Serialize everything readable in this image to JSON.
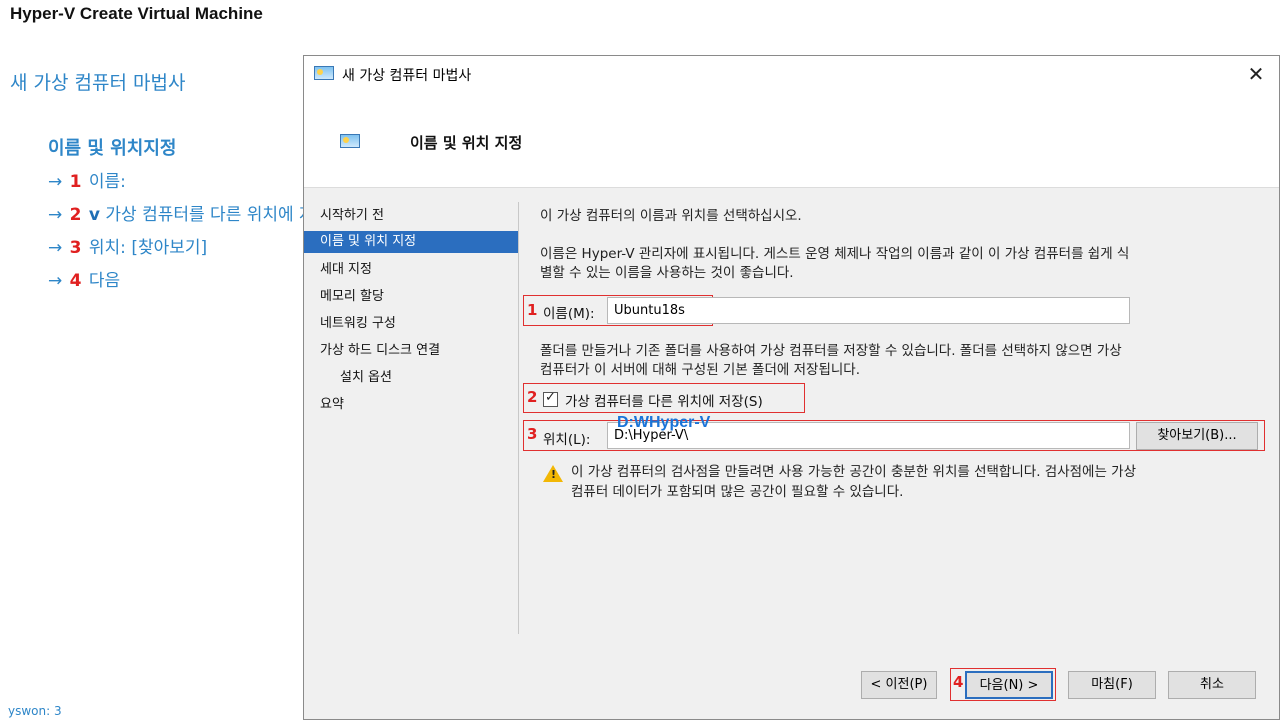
{
  "slide": {
    "title": "Hyper-V Create Virtual Machine",
    "wizard_heading": "새 가상 컴퓨터 마법사",
    "steps_heading": "이름 및 위치지정",
    "steps": [
      {
        "arrow": "→",
        "num": "1",
        "text": "이름:"
      },
      {
        "arrow": "→",
        "num": "2",
        "check": "v",
        "text": "가상 컴퓨터를 다른 위치에 저장"
      },
      {
        "arrow": "→",
        "num": "3",
        "text": "위치: [찾아보기]"
      },
      {
        "arrow": "→",
        "num": "4",
        "text": "다음"
      }
    ],
    "author": "yswon:   3"
  },
  "dialog": {
    "title": "새 가상 컴퓨터 마법사",
    "close_label": "✕",
    "header_title": "이름 및 위치 지정",
    "nav": [
      {
        "label": "시작하기 전"
      },
      {
        "label": "이름 및 위치 지정",
        "active": true
      },
      {
        "label": "세대 지정"
      },
      {
        "label": "메모리 할당"
      },
      {
        "label": "네트워킹 구성"
      },
      {
        "label": "가상 하드 디스크 연결"
      },
      {
        "label": "설치 옵션",
        "sub": true
      },
      {
        "label": "요약"
      }
    ],
    "intro": "이 가상 컴퓨터의 이름과 위치를 선택하십시오.",
    "desc1_line1": "이름은 Hyper-V 관리자에 표시됩니다. 게스트 운영 체제나 작업의 이름과 같이 이 가상 컴퓨터를 쉽게 식",
    "desc1_line2": "별할 수 있는 이름을 사용하는 것이 좋습니다.",
    "name_label": "이름(M):",
    "name_value": "Ubuntu18s",
    "desc2_line1": "폴더를 만들거나 기존 폴더를 사용하여 가상 컴퓨터를 저장할 수 있습니다. 폴더를 선택하지 않으면 가상",
    "desc2_line2": "컴퓨터가 이 서버에 대해 구성된 기본 폴더에 저장됩니다.",
    "store_checkbox_label": "가상 컴퓨터를 다른 위치에 저장(S)",
    "location_label": "위치(L):",
    "location_value": "D:\\Hyper-V\\",
    "location_overlay": "D:WHyper-V",
    "browse_label": "찾아보기(B)...",
    "warning_line1": "이 가상 컴퓨터의 검사점을 만들려면 사용 가능한 공간이 충분한 위치를 선택합니다. 검사점에는 가상",
    "warning_line2": "컴퓨터 데이터가 포함되며 많은 공간이 필요할 수 있습니다.",
    "markers": {
      "m1": "1",
      "m2": "2",
      "m3": "3",
      "m4": "4"
    },
    "buttons": {
      "prev": "< 이전(P)",
      "next": "다음(N) >",
      "finish": "마침(F)",
      "cancel": "취소"
    }
  }
}
